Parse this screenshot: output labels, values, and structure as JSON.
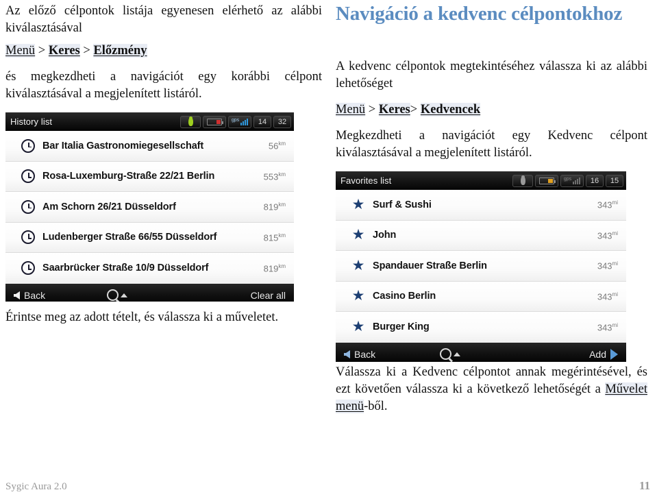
{
  "left_column": {
    "intro_paragraph": "Az előző célpontok listája egyenesen elérhető az alábbi kiválasztásával",
    "menu_path": {
      "item1": "Menü",
      "sep1": " > ",
      "item2": "Keres",
      "sep2": " > ",
      "item3": "Előzmény"
    },
    "after_path_paragraph": "és megkezdheti a navigációt egy korábbi célpont kiválasztásával a megjelenített listáról.",
    "below_device_paragraph": "Érintse meg az adott tételt, és válassza ki a műveletet."
  },
  "right_column": {
    "heading": "Navigáció a kedvenc célpontokhoz",
    "intro_paragraph": "A kedvenc célpontok megtekintéséhez válassza ki az alábbi lehetőséget",
    "menu_path": {
      "item1": "Menü",
      "sep1": " > ",
      "item2": "Keres",
      "sep2": "> ",
      "item3": "Kedvencek"
    },
    "after_path_paragraph": "Megkezdheti a navigációt egy Kedvenc célpont kiválasztásával a megjelenített listáról.",
    "below_device_paragraph_start": "Válassza ki a Kedvenc célpontot annak megérintésével, és ezt követően válassza ki a következő lehetőségét a ",
    "below_device_link": "Művelet menü",
    "below_device_paragraph_end": "-ből."
  },
  "history_device": {
    "title": "History list",
    "status": {
      "person_icon": "person-icon",
      "battery_icon": "battery-icon",
      "gps_icon": "gps-signal-icon",
      "value1": "14",
      "value2": "32"
    },
    "rows": [
      {
        "icon": "clock-icon",
        "label": "Bar Italia Gastronomiegesellschaft",
        "distance": "56",
        "unit": "km"
      },
      {
        "icon": "clock-icon",
        "label": "Rosa-Luxemburg-Straße 22/21  Berlin",
        "distance": "553",
        "unit": "km"
      },
      {
        "icon": "clock-icon",
        "label": "Am Schorn 26/21  Düsseldorf",
        "distance": "819",
        "unit": "km"
      },
      {
        "icon": "clock-icon",
        "label": "Ludenberger Straße 66/55  Düsseldorf",
        "distance": "815",
        "unit": "km"
      },
      {
        "icon": "clock-icon",
        "label": "Saarbrücker Straße 10/9  Düsseldorf",
        "distance": "819",
        "unit": "km"
      }
    ],
    "toolbar": {
      "back_label": "Back",
      "search_icon": "magnifier-icon",
      "right_label": "Clear all"
    }
  },
  "favorites_device": {
    "title": "Favorites list",
    "status": {
      "person_icon": "person-icon",
      "battery_icon": "battery-icon",
      "gps_icon": "gps-signal-icon",
      "value1": "16",
      "value2": "15"
    },
    "rows": [
      {
        "icon": "star-icon",
        "label": "Surf & Sushi",
        "distance": "343",
        "unit": "mi"
      },
      {
        "icon": "star-icon",
        "label": "John",
        "distance": "343",
        "unit": "mi"
      },
      {
        "icon": "star-icon",
        "label": "Spandauer Straße  Berlin",
        "distance": "343",
        "unit": "mi"
      },
      {
        "icon": "star-icon",
        "label": "Casino Berlin",
        "distance": "343",
        "unit": "mi"
      },
      {
        "icon": "star-icon",
        "label": "Burger King",
        "distance": "343",
        "unit": "mi"
      }
    ],
    "toolbar": {
      "back_label": "Back",
      "search_icon": "magnifier-icon",
      "right_label": "Add"
    }
  },
  "footer": {
    "product": "Sygic Aura 2.0",
    "page_number": "11"
  },
  "colors": {
    "heading_blue": "#5b8cc0",
    "link_highlight": "#e8ecf4",
    "star_blue": "#1d3f73",
    "accent_blue": "#5a9bd8",
    "footer_gray": "#9a9a9a"
  }
}
